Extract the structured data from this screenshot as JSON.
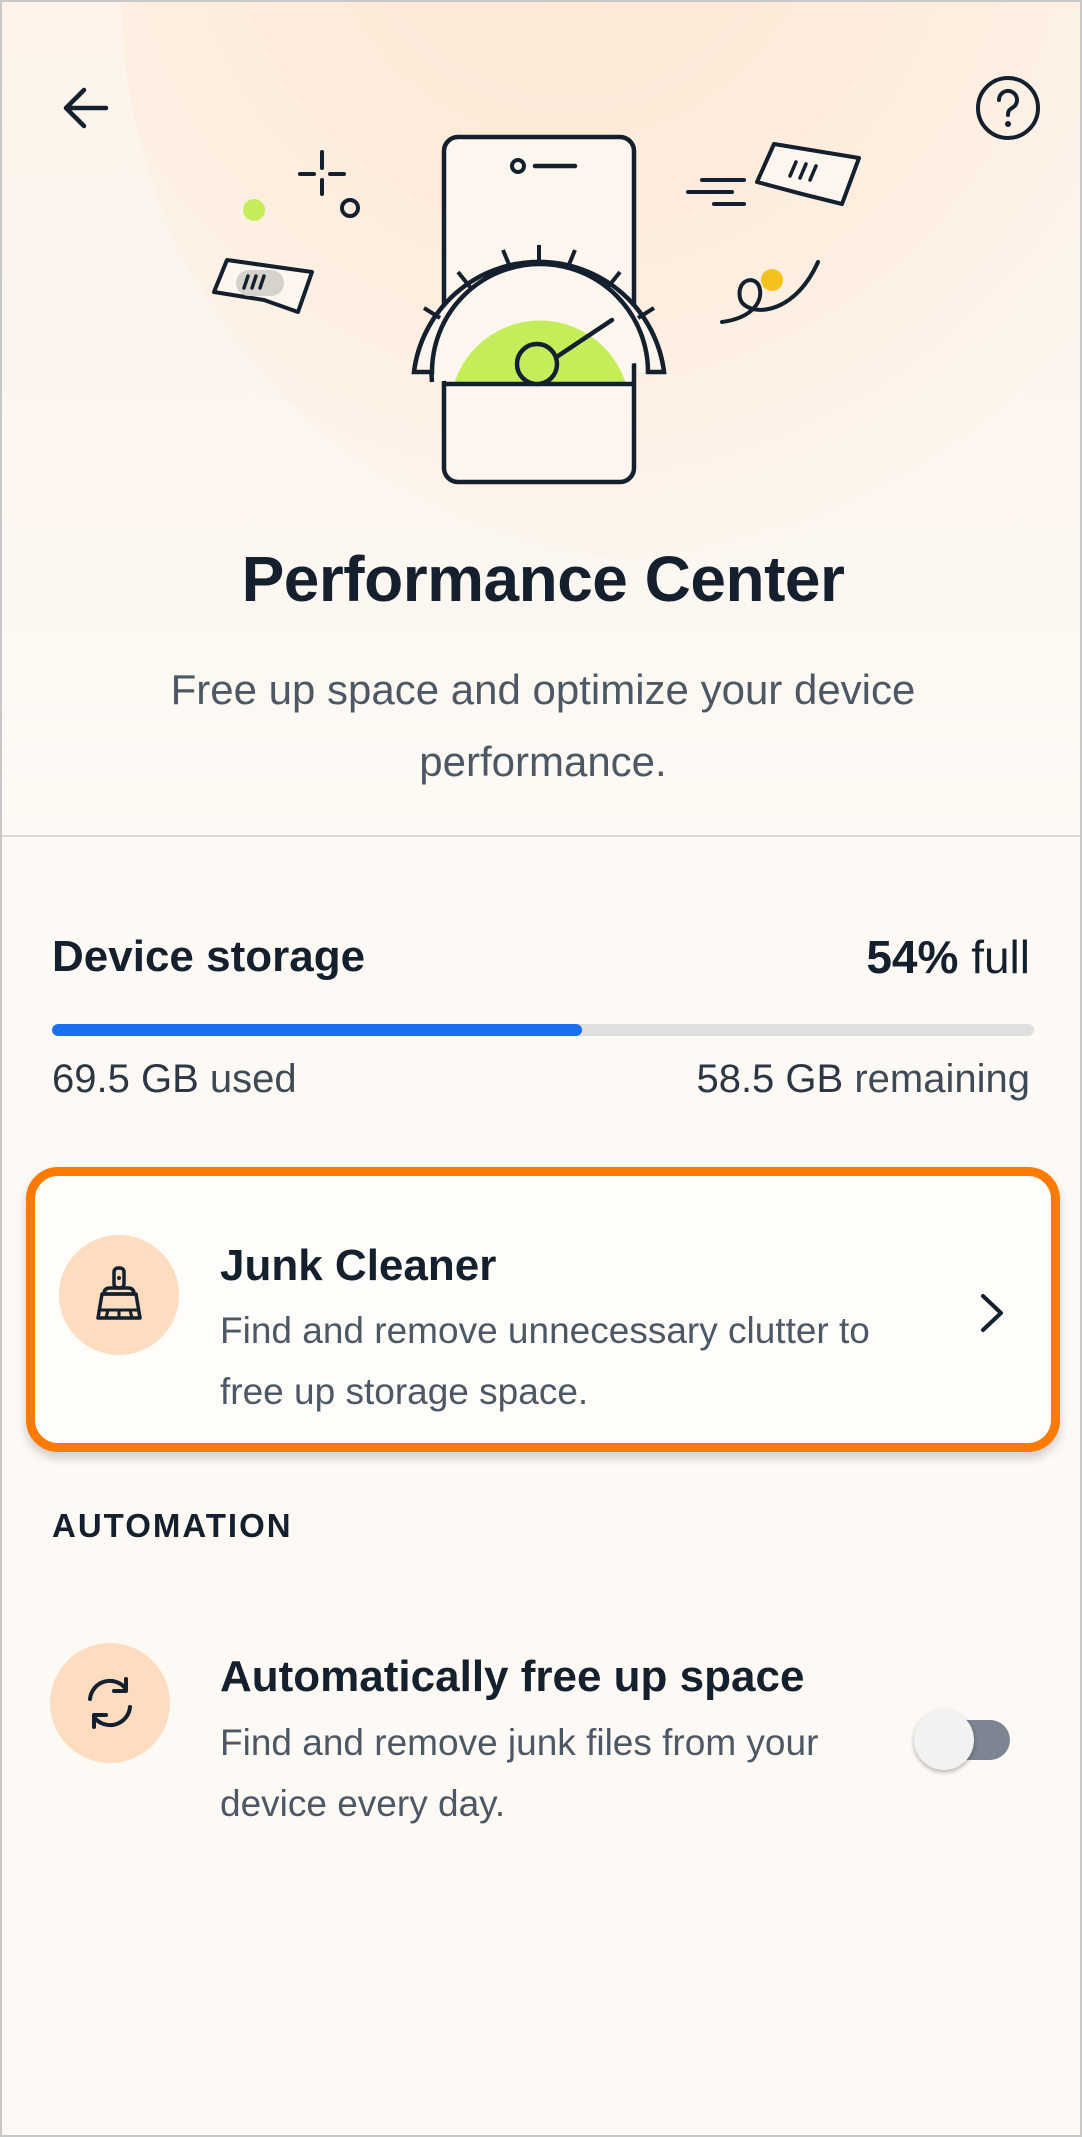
{
  "header": {
    "back_icon": "arrow-left-icon",
    "help_icon": "question-circle-icon",
    "title": "Performance Center",
    "subtitle": "Free up space and optimize your device performance."
  },
  "storage": {
    "title": "Device storage",
    "percent": "54%",
    "percent_suffix": "full",
    "fill_fraction": 0.54,
    "used_value": "69.5 GB",
    "used_label": "used",
    "remaining_value": "58.5 GB",
    "remaining_label": "remaining"
  },
  "junk_cleaner": {
    "icon": "broom-icon",
    "title": "Junk Cleaner",
    "description": "Find and remove unnecessary clutter to free up storage space."
  },
  "automation": {
    "section_label": "AUTOMATION",
    "icon": "sync-icon",
    "title": "Automatically free up space",
    "description": "Find and remove junk files from your device every day.",
    "enabled": false
  },
  "colors": {
    "accent_blue": "#1a6ff0",
    "highlight_orange": "#ff7a00",
    "icon_bg": "#fddcc0",
    "gauge_green": "#c3ee5a"
  }
}
